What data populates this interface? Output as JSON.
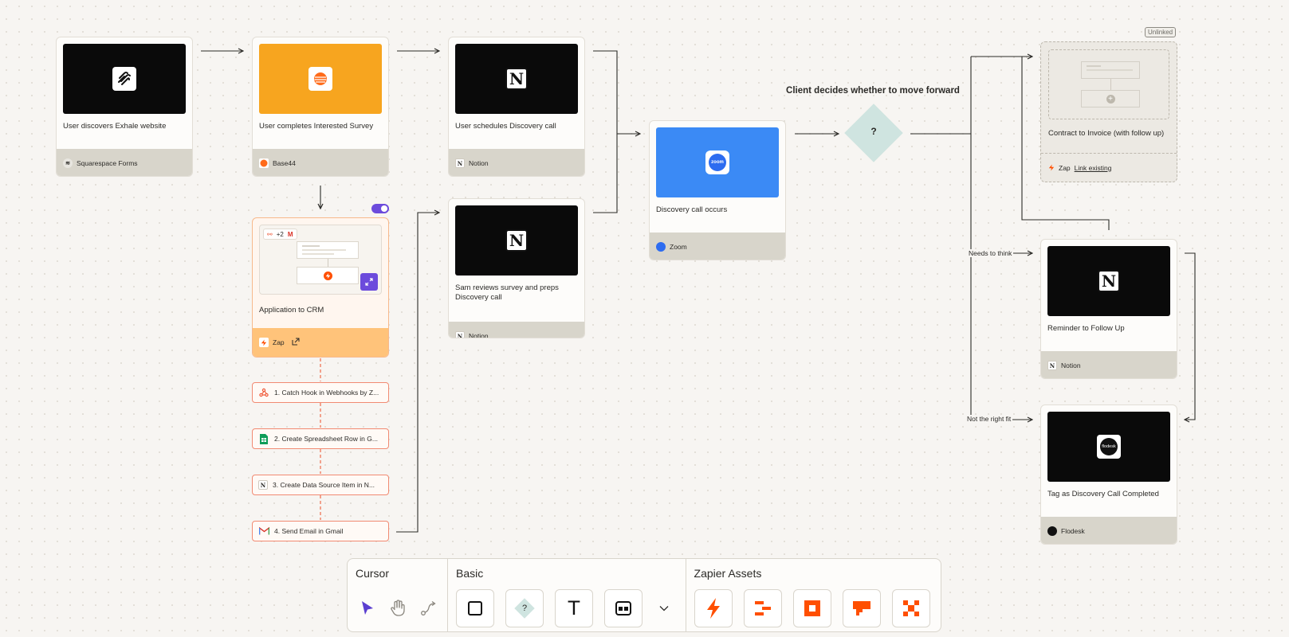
{
  "nodes": {
    "n1": {
      "title": "User discovers Exhale website",
      "app": "Squarespace Forms",
      "icon": "squarespace-icon"
    },
    "n2": {
      "title": "User completes Interested Survey",
      "app": "Base44",
      "icon": "base44-icon"
    },
    "n3": {
      "title": "User schedules Discovery call",
      "app": "Notion",
      "icon": "notion-icon"
    },
    "n4": {
      "title": "Sam reviews survey and preps Discovery call",
      "app": "Notion",
      "icon": "notion-icon"
    },
    "n5": {
      "title": "Discovery call occurs",
      "app": "Zoom",
      "icon": "zoom-icon"
    },
    "n6": {
      "title": "Reminder to Follow Up",
      "app": "Notion",
      "icon": "notion-icon"
    },
    "n7": {
      "title": "Tag as Discovery Call Completed",
      "app": "Flodesk",
      "icon": "flodesk-icon"
    }
  },
  "zap": {
    "title": "Application to CRM",
    "footer": "Zap",
    "preview_count": "+2",
    "toggle_on": true,
    "steps": [
      {
        "label": "1. Catch Hook in Webhooks by Z...",
        "icon": "webhook-icon"
      },
      {
        "label": "2. Create Spreadsheet Row in G...",
        "icon": "google-sheets-icon"
      },
      {
        "label": "3. Create Data Source Item in N...",
        "icon": "notion-icon"
      },
      {
        "label": "4. Send Email in Gmail",
        "icon": "gmail-icon"
      }
    ]
  },
  "decision": {
    "title": "Client decides whether to move forward",
    "symbol": "?",
    "branches": [
      "Needs to think",
      "Not the right fit"
    ]
  },
  "unlinked": {
    "badge": "Unlinked",
    "title": "Contract to Invoice (with follow up)",
    "footer_prefix": "Zap",
    "link_text": "Link existing"
  },
  "zoom_logo_text": "zoom",
  "flodesk_logo_text": "flodesk",
  "toolbar": {
    "cursor": {
      "title": "Cursor",
      "tools": [
        "pointer-tool",
        "hand-tool",
        "connector-tool"
      ]
    },
    "basic": {
      "title": "Basic",
      "tools": [
        "rectangle-tool",
        "decision-tool",
        "text-tool",
        "component-tool",
        "more-chevron"
      ],
      "text_glyph": "T",
      "decision_glyph": "?"
    },
    "assets": {
      "title": "Zapier Assets",
      "tools": [
        "zap-asset",
        "table-asset",
        "interface-asset",
        "chatbot-asset",
        "canvas-asset"
      ]
    }
  },
  "colors": {
    "accent_purple": "#6c4bdc",
    "zapier_orange": "#ff4f00",
    "zap_fill": "#ffc37a",
    "base44_orange": "#f7a51f",
    "zoom_blue": "#3b8af5",
    "decision_teal": "#cfe4e0",
    "card_footer": "#d8d5cb"
  }
}
